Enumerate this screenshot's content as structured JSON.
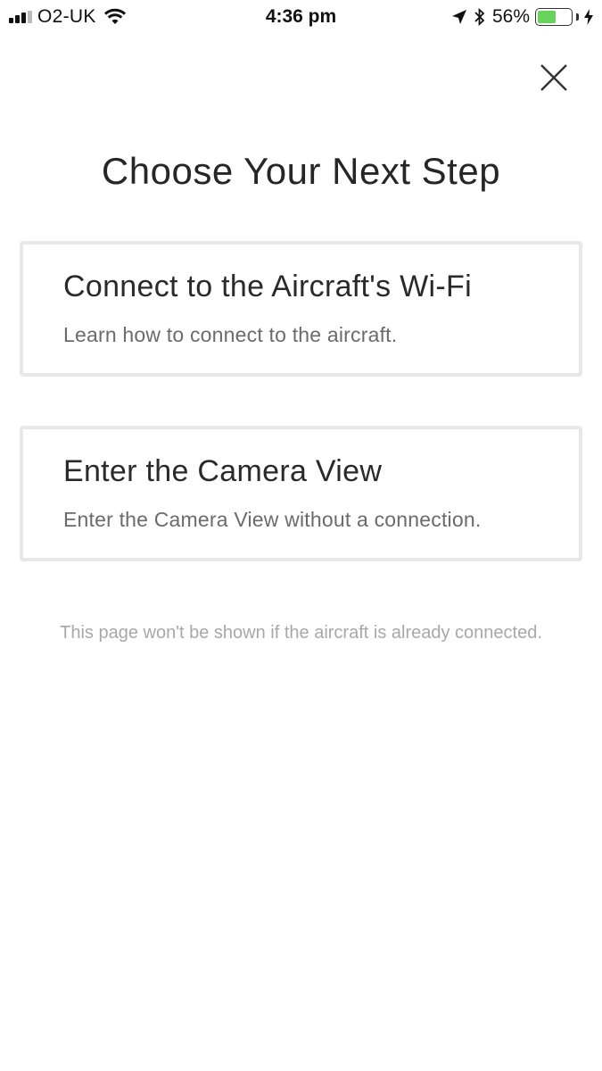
{
  "status_bar": {
    "carrier": "O2-UK",
    "time": "4:36 pm",
    "battery_percent": "56%",
    "battery_level": 0.56,
    "battery_color": "#67d35b",
    "icons": [
      "signal-bars-icon",
      "wifi-icon",
      "location-arrow-icon",
      "bluetooth-icon",
      "battery-icon",
      "charging-bolt-icon"
    ]
  },
  "header": {
    "close_icon": "close-icon"
  },
  "page": {
    "title": "Choose Your Next Step"
  },
  "options": [
    {
      "title": "Connect to the Aircraft's Wi-Fi",
      "description": "Learn how to connect to the aircraft."
    },
    {
      "title": "Enter the Camera View",
      "description": "Enter the Camera View without a connection."
    }
  ],
  "footer": {
    "note": "This page won't be shown if the aircraft is already connected."
  }
}
